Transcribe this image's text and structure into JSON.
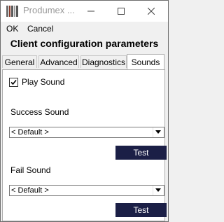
{
  "window": {
    "title": "Produmex ...",
    "colors": {
      "titlebar": "#ffffff",
      "background": "#f0f0f0",
      "button": "#1b1f46"
    }
  },
  "menu": {
    "ok": "OK",
    "cancel": "Cancel"
  },
  "heading": "Client configuration parameters",
  "tabs": [
    {
      "label": "General"
    },
    {
      "label": "Advanced"
    },
    {
      "label": "Diagnostics"
    },
    {
      "label": "Sounds",
      "active": true
    }
  ],
  "sounds": {
    "play_sound_label": "Play Sound",
    "play_sound_checked": true,
    "success_label": "Success Sound",
    "success_value": "< Default >",
    "fail_label": "Fail Sound",
    "fail_value": "< Default >",
    "test_label": "Test"
  }
}
